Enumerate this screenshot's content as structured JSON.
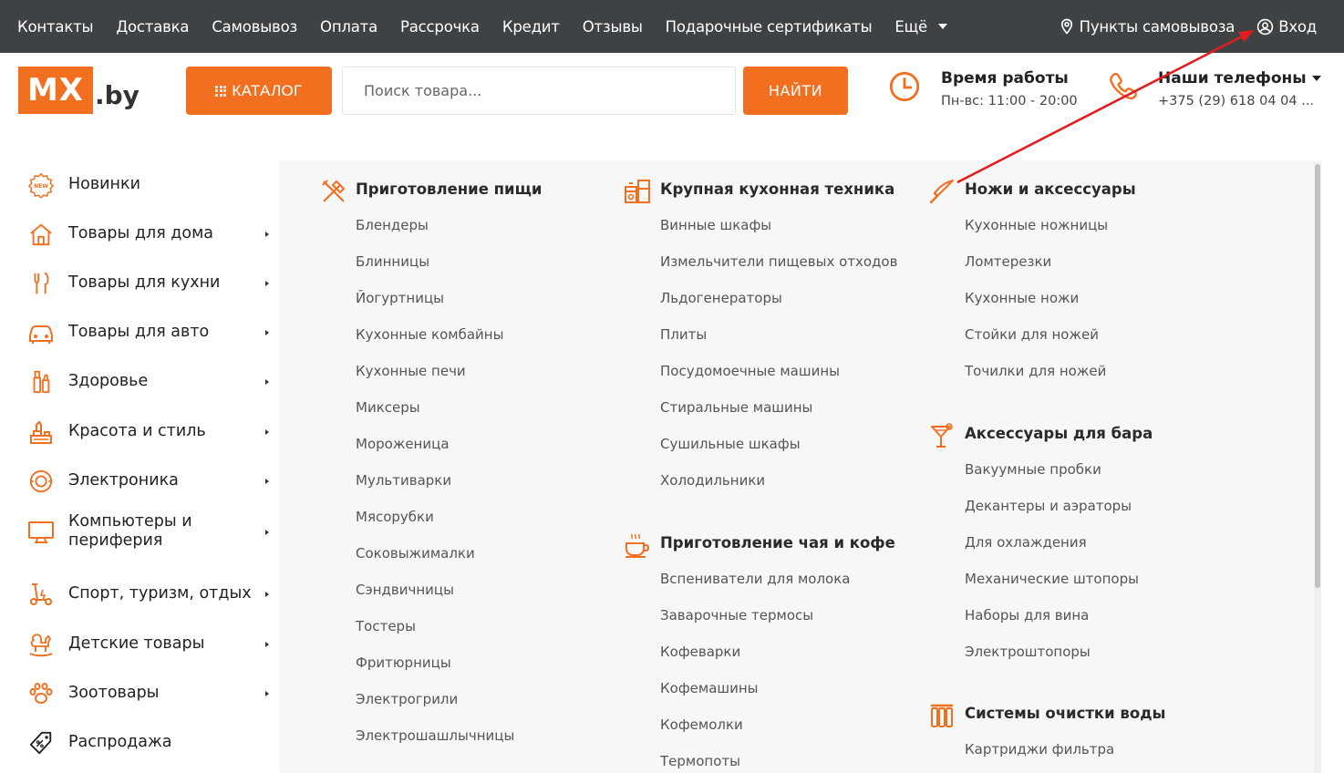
{
  "topnav": {
    "links": [
      "Контакты",
      "Доставка",
      "Самовывоз",
      "Оплата",
      "Рассрочка",
      "Кредит",
      "Отзывы",
      "Подарочные сертификаты"
    ],
    "more_label": "Ещё",
    "pickup_points": "Пункты самовывоза",
    "login": "Вход"
  },
  "header": {
    "logo_mark": "MX",
    "logo_domain": ".by",
    "catalog_label": "КАТАЛОГ",
    "search_placeholder": "Поиск товара...",
    "search_button": "НАЙТИ",
    "hours_title": "Время работы",
    "hours_value": "Пн-вс: 11:00 - 20:00",
    "phones_title": "Наши телефоны",
    "phone_value": "+375 (29) 618 04 04 ..."
  },
  "sidebar": {
    "items": [
      {
        "label": "Новинки",
        "icon": "new-badge-icon",
        "has_submenu": false
      },
      {
        "label": "Товары для дома",
        "icon": "house-icon",
        "has_submenu": true
      },
      {
        "label": "Товары для кухни",
        "icon": "kitchen-utensils-icon",
        "has_submenu": true
      },
      {
        "label": "Товары для авто",
        "icon": "car-icon",
        "has_submenu": true
      },
      {
        "label": "Здоровье",
        "icon": "health-bottles-icon",
        "has_submenu": true
      },
      {
        "label": "Красота и стиль",
        "icon": "cosmetics-icon",
        "has_submenu": true
      },
      {
        "label": "Электроника",
        "icon": "electronics-icon",
        "has_submenu": true
      },
      {
        "label": "Компьютеры и",
        "label2": "периферия",
        "icon": "monitor-icon",
        "has_submenu": true
      },
      {
        "label": "Спорт, туризм, отдых",
        "icon": "scooter-icon",
        "has_submenu": true
      },
      {
        "label": "Детские товары",
        "icon": "rocking-horse-icon",
        "has_submenu": true
      },
      {
        "label": "Зоотовары",
        "icon": "paw-icon",
        "has_submenu": true
      },
      {
        "label": "Распродажа",
        "icon": "sale-tag-icon",
        "has_submenu": false
      }
    ]
  },
  "menu": {
    "groups": [
      {
        "title": "Приготовление пищи",
        "icon": "cooking-utensils-icon",
        "items": [
          "Блендеры",
          "Блинницы",
          "Йогуртницы",
          "Кухонные комбайны",
          "Кухонные печи",
          "Миксеры",
          "Мороженица",
          "Мультиварки",
          "Мясорубки",
          "Соковыжималки",
          "Сэндвичницы",
          "Тостеры",
          "Фритюрницы",
          "Электрогрили",
          "Электрошашлычницы"
        ]
      },
      {
        "title": "Крупная кухонная техника",
        "icon": "kitchen-appliance-icon",
        "items": [
          "Винные шкафы",
          "Измельчители пищевых отходов",
          "Льдогенераторы",
          "Плиты",
          "Посудомоечные машины",
          "Стиральные машины",
          "Сушильные шкафы",
          "Холодильники"
        ]
      },
      {
        "title": "Приготовление чая и кофе",
        "icon": "coffee-cup-icon",
        "items": [
          "Вспениватели для молока",
          "Заварочные термосы",
          "Кофеварки",
          "Кофемашины",
          "Кофемолки",
          "Термопоты"
        ]
      },
      {
        "title": "Ножи и аксессуары",
        "icon": "knife-icon",
        "items": [
          "Кухонные ножницы",
          "Ломтерезки",
          "Кухонные ножи",
          "Стойки для ножей",
          "Точилки для ножей"
        ]
      },
      {
        "title": "Аксессуары для бара",
        "icon": "cocktail-glass-icon",
        "items": [
          "Вакуумные пробки",
          "Декантеры и аэраторы",
          "Для охлаждения",
          "Механические штопоры",
          "Наборы для вина",
          "Электроштопоры"
        ]
      },
      {
        "title": "Системы очистки воды",
        "icon": "water-filter-icon",
        "items": [
          "Картриджи фильтра"
        ]
      }
    ]
  },
  "colors": {
    "accent": "#f26f1f",
    "topbar": "#3f4244",
    "panel_bg": "#f7f7f7",
    "annotation_arrow": "#e11d1d"
  }
}
